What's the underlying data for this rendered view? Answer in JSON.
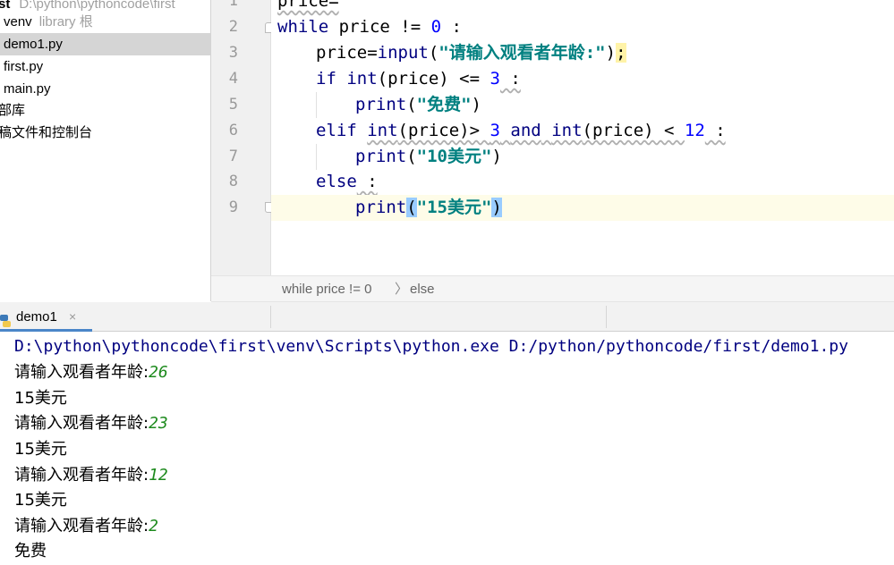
{
  "project": {
    "root_label": "st",
    "root_path": "D:\\python\\pythoncode\\first",
    "venv_label": "venv",
    "venv_hint": "library 根",
    "files": [
      "demo1.py",
      "first.py",
      "main.py"
    ],
    "external_libraries": "部库",
    "scratches": "稿文件和控制台"
  },
  "editor": {
    "line_numbers": [
      "1",
      "2",
      "3",
      "4",
      "5",
      "6",
      "7",
      "8",
      "9"
    ],
    "l1": "price=",
    "l2": {
      "kw": "while",
      "a": " price != ",
      "num": "0",
      "b": " :"
    },
    "l3": {
      "a": "price=",
      "fn": "input",
      "p1": "(",
      "str": "\"请输入观看者年龄:\"",
      "p2": ")",
      "semi": ";"
    },
    "l4": {
      "kw": "if",
      "sp": " ",
      "fn": "int",
      "a": "(price) <= ",
      "num": "3",
      "b": " :"
    },
    "l5": {
      "fn": "print",
      "a": "(",
      "str": "\"免费\"",
      "b": ")"
    },
    "l6": {
      "kw": "elif",
      "sp": " ",
      "fn1": "int",
      "a": "(price)> ",
      "num1": "3",
      "sp2": " ",
      "and": "and",
      "sp3": " ",
      "fn2": "int",
      "b": "(price) < ",
      "num2": "12",
      "c": " :"
    },
    "l7": {
      "fn": "print",
      "a": "(",
      "str": "\"10美元\"",
      "b": ")"
    },
    "l8": {
      "kw": "else",
      "b": " :"
    },
    "l9": {
      "fn": "print",
      "a": "(",
      "str": "\"15美元\"",
      "b": ")"
    }
  },
  "breadcrumb": {
    "first": "while price != 0",
    "second": "else"
  },
  "run": {
    "tab_label": "demo1",
    "close": "×",
    "command": "D:\\python\\pythoncode\\first\\venv\\Scripts\\python.exe D:/python/pythoncode/first/demo1.py",
    "prompt": "请输入观看者年龄:",
    "inputs": [
      "26",
      "23",
      "12",
      "2"
    ],
    "outputs": [
      "15美元",
      "15美元",
      "15美元",
      "免费"
    ]
  }
}
